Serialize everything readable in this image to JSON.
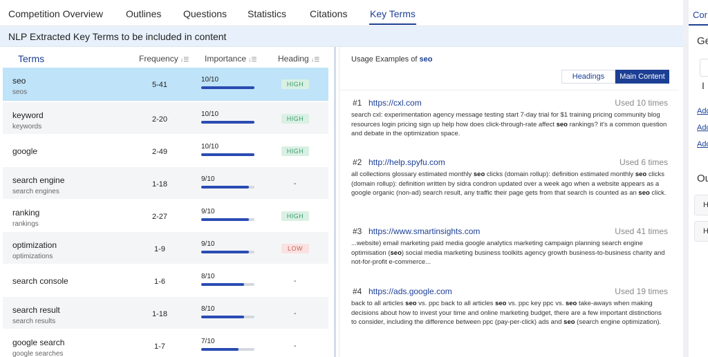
{
  "tabs": [
    {
      "label": "Competition Overview"
    },
    {
      "label": "Outlines"
    },
    {
      "label": "Questions"
    },
    {
      "label": "Statistics"
    },
    {
      "label": "Citations"
    },
    {
      "label": "Key Terms",
      "active": true
    }
  ],
  "banner": "NLP Extracted Key Terms to be included in content",
  "table": {
    "headers": {
      "terms": "Terms",
      "frequency": "Frequency",
      "importance": "Importance",
      "heading": "Heading"
    },
    "rows": [
      {
        "term": "seo",
        "variant": "seos",
        "frequency": "5-41",
        "importance": "10/10",
        "importance_value": 10,
        "heading": "HIGH",
        "heading_kind": "high",
        "selected": true
      },
      {
        "term": "keyword",
        "variant": "keywords",
        "frequency": "2-20",
        "importance": "10/10",
        "importance_value": 10,
        "heading": "HIGH",
        "heading_kind": "high"
      },
      {
        "term": "google",
        "variant": "",
        "frequency": "2-49",
        "importance": "10/10",
        "importance_value": 10,
        "heading": "HIGH",
        "heading_kind": "high"
      },
      {
        "term": "search engine",
        "variant": "search engines",
        "frequency": "1-18",
        "importance": "9/10",
        "importance_value": 9,
        "heading": "-",
        "heading_kind": "dash"
      },
      {
        "term": "ranking",
        "variant": "rankings",
        "frequency": "2-27",
        "importance": "9/10",
        "importance_value": 9,
        "heading": "HIGH",
        "heading_kind": "high"
      },
      {
        "term": "optimization",
        "variant": "optimizations",
        "frequency": "1-9",
        "importance": "9/10",
        "importance_value": 9,
        "heading": "LOW",
        "heading_kind": "low"
      },
      {
        "term": "search console",
        "variant": "",
        "frequency": "1-6",
        "importance": "8/10",
        "importance_value": 8,
        "heading": "-",
        "heading_kind": "dash"
      },
      {
        "term": "search result",
        "variant": "search results",
        "frequency": "1-18",
        "importance": "8/10",
        "importance_value": 8,
        "heading": "-",
        "heading_kind": "dash"
      },
      {
        "term": "google search",
        "variant": "google searches",
        "frequency": "1-7",
        "importance": "7/10",
        "importance_value": 7,
        "heading": "-",
        "heading_kind": "dash"
      }
    ]
  },
  "usage": {
    "title_prefix": "Usage Examples of",
    "term": "seo",
    "toggle": {
      "headings": "Headings",
      "main_content": "Main Content",
      "active": "main_content"
    },
    "examples": [
      {
        "num": "#1",
        "url": "https://cxl.com",
        "used": "Used 10 times",
        "text": "search cxl: experimentation agency message testing start 7-day trial for $1 training pricing community blog resources login pricing sign up help how does click-through-rate affect **seo** rankings? it's a common question and debate in the optimization space."
      },
      {
        "num": "#2",
        "url": "http://help.spyfu.com",
        "used": "Used 6 times",
        "text": "all collections glossary estimated monthly **seo** clicks (domain rollup): definition estimated monthly **seo** clicks (domain rollup): definition written by sidra condron updated over a week ago when a website appears as a google organic (non-ad) search result, any traffic their page gets from that search is counted as an **seo** click."
      },
      {
        "num": "#3",
        "url": "https://www.smartinsights.com",
        "used": "Used 41 times",
        "text": "...website) email marketing paid media google analytics marketing campaign planning search engine optimisation (**seo**) social media marketing business toolkits agency growth business-to-business charity and not-for-profit e-commerce..."
      },
      {
        "num": "#4",
        "url": "https://ads.google.com",
        "used": "Used 19 times",
        "text": "back to all articles **seo** vs. ppc back to all articles **seo** vs. ppc key ppc vs. **seo** take-aways when making decisions about how to invest your time and online marketing budget, there are a few important distinctions to consider, including the difference between ppc (pay-per-click) ads and **seo** (search engine optimization)."
      }
    ]
  },
  "sidebar": {
    "tab": "Cor",
    "ge": "Ge",
    "i": "I",
    "links": [
      "Add",
      "Add",
      "Add"
    ],
    "ou": "Ou",
    "boxes": [
      "H",
      "H"
    ]
  },
  "colors": {
    "accent": "#1c3f94",
    "bar": "#2a4cb3",
    "selected_row": "#bfe3f8",
    "badge_high_bg": "#d9f0e4",
    "badge_low_bg": "#fbe1e1"
  }
}
